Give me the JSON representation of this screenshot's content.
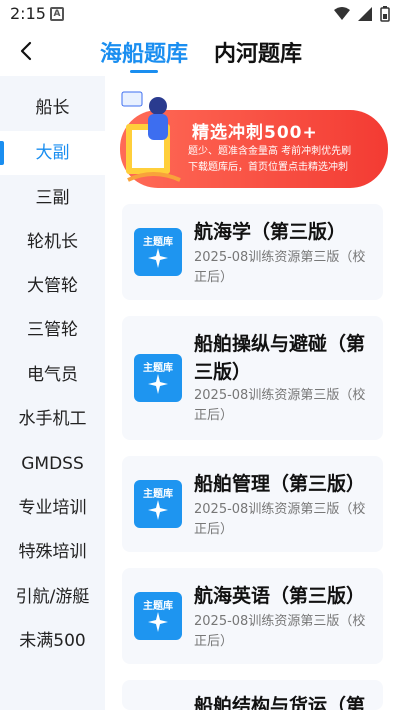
{
  "status_bar": {
    "time": "2:15",
    "notification_letter": "A"
  },
  "header": {
    "tabs": [
      {
        "label": "海船题库",
        "active": true
      },
      {
        "label": "内河题库",
        "active": false
      }
    ],
    "accent_color": "#1a8ef0"
  },
  "sidebar": {
    "items": [
      {
        "label": "船长"
      },
      {
        "label": "大副",
        "active": true
      },
      {
        "label": "三副"
      },
      {
        "label": "轮机长"
      },
      {
        "label": "大管轮"
      },
      {
        "label": "三管轮"
      },
      {
        "label": "电气员"
      },
      {
        "label": "水手机工"
      },
      {
        "label": "GMDSS"
      },
      {
        "label": "专业培训"
      },
      {
        "label": "特殊培训"
      },
      {
        "label": "引航/游艇"
      },
      {
        "label": "未满500"
      }
    ]
  },
  "banner": {
    "title": "精选冲刺500+",
    "line1": "题少、题准含金量高 考前冲刺优先刷",
    "line2": "下载题库后，首页位置点击精选冲刺",
    "color": "#f33b33"
  },
  "cards": [
    {
      "badge": "主题库",
      "title": "航海学（第三版）",
      "meta": "2025-08训练资源第三版（校正后）"
    },
    {
      "badge": "主题库",
      "title": "船舶操纵与避碰（第三版）",
      "meta": "2025-08训练资源第三版（校正后）"
    },
    {
      "badge": "主题库",
      "title": "船舶管理（第三版）",
      "meta": "2025-08训练资源第三版（校正后）"
    },
    {
      "badge": "主题库",
      "title": "航海英语（第三版）",
      "meta": "2025-08训练资源第三版（校正后）"
    },
    {
      "badge": "主题库",
      "title": "船舶结构与货运（第",
      "meta": ""
    }
  ]
}
